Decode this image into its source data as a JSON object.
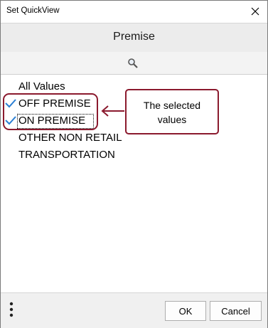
{
  "window": {
    "title": "Set QuickView"
  },
  "header": {
    "title": "Premise"
  },
  "search": {
    "icon": "search-icon"
  },
  "list": {
    "items": [
      {
        "label": "All Values",
        "checked": false
      },
      {
        "label": "OFF PREMISE",
        "checked": true
      },
      {
        "label": "ON PREMISE",
        "checked": true
      },
      {
        "label": "OTHER NON RETAIL",
        "checked": false
      },
      {
        "label": "TRANSPORTATION",
        "checked": false
      }
    ]
  },
  "callout": {
    "text_line1": "The selected",
    "text_line2": "values",
    "color": "#8b1a2e"
  },
  "footer": {
    "ok_label": "OK",
    "cancel_label": "Cancel",
    "more_icon": "more-vertical-icon"
  },
  "colors": {
    "check": "#2a7fd4",
    "accent": "#8b1a2e"
  }
}
